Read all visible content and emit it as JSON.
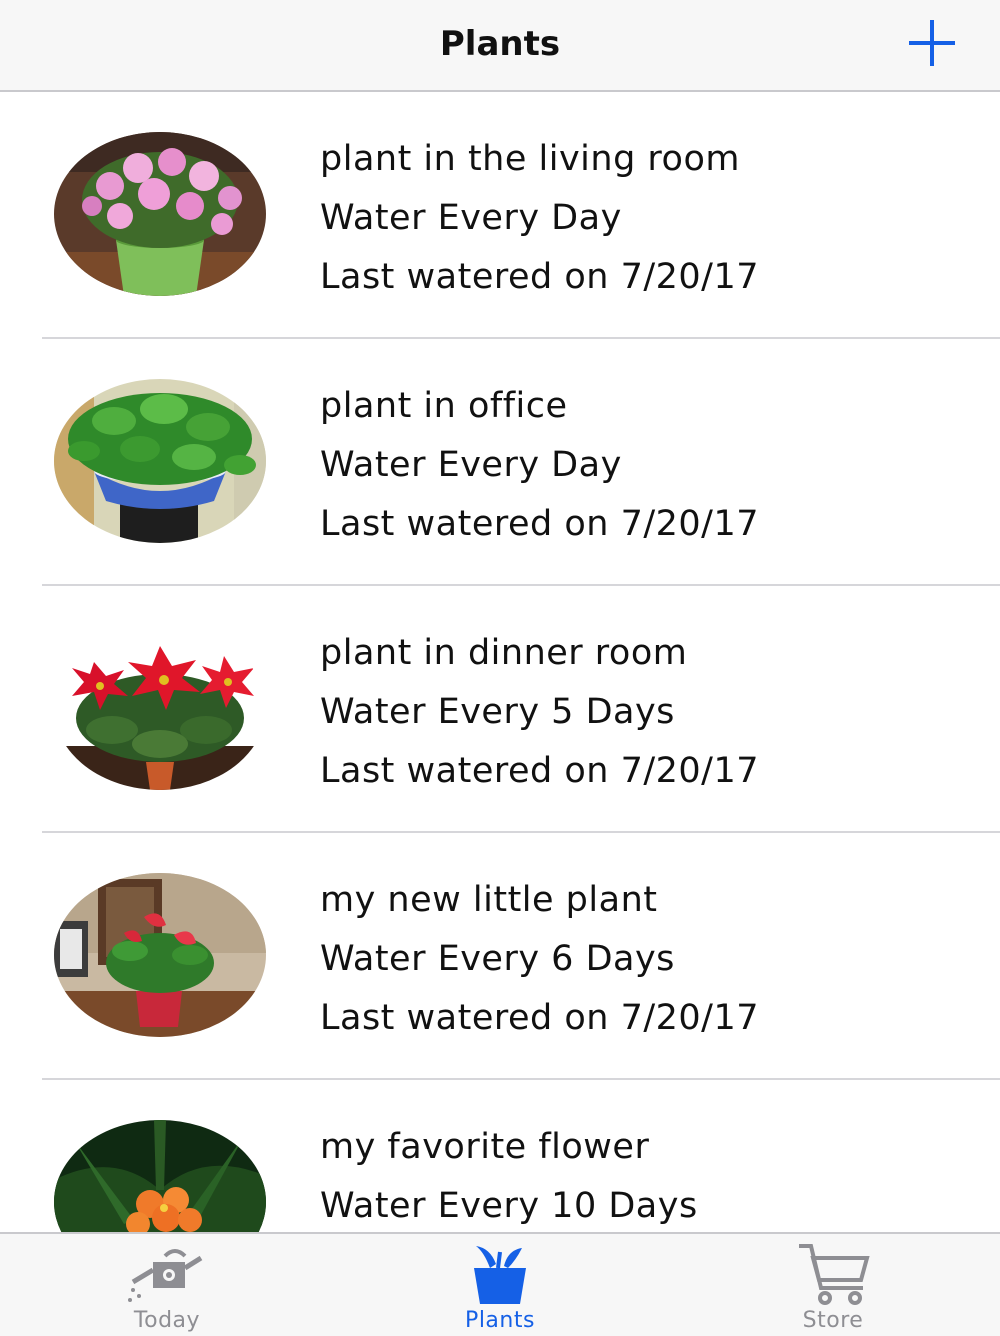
{
  "navbar": {
    "title": "Plants",
    "add_icon": "plus-icon",
    "accent_color": "#1560e6"
  },
  "plants": [
    {
      "name": "plant in the living room",
      "frequency": "Water Every Day",
      "last_watered": "Last watered on 7/20/17",
      "photo": "pink-azalea-photo"
    },
    {
      "name": "plant in office",
      "frequency": "Water Every Day",
      "last_watered": "Last watered on 7/20/17",
      "photo": "pothos-photo"
    },
    {
      "name": "plant in dinner room",
      "frequency": "Water Every 5 Days",
      "last_watered": "Last watered on 7/20/17",
      "photo": "poinsettia-photo"
    },
    {
      "name": "my new little plant",
      "frequency": "Water Every 6 Days",
      "last_watered": "Last watered on 7/20/17",
      "photo": "anthurium-photo"
    },
    {
      "name": "my favorite flower",
      "frequency": "Water Every 10 Days",
      "last_watered": "",
      "photo": "clivia-photo"
    }
  ],
  "tabbar": {
    "tabs": [
      {
        "label": "Today",
        "icon": "watering-can-icon",
        "active": false
      },
      {
        "label": "Plants",
        "icon": "flower-pot-icon",
        "active": true
      },
      {
        "label": "Store",
        "icon": "shopping-cart-icon",
        "active": false
      }
    ],
    "active_color": "#1560e6",
    "inactive_color": "#8e8e93"
  }
}
